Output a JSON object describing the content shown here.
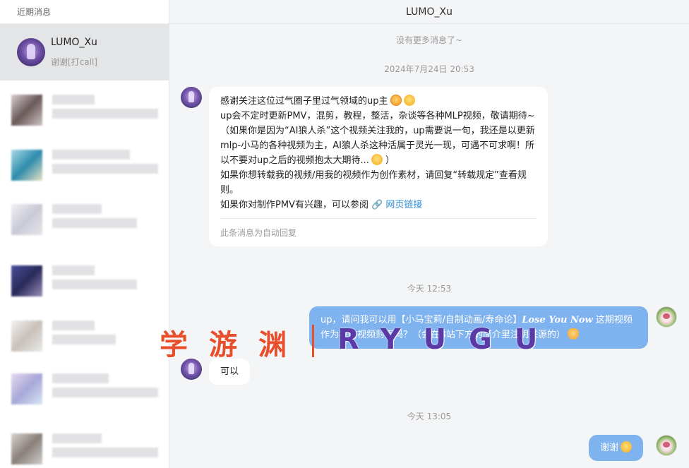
{
  "sidebar": {
    "header": "近期消息",
    "active_conversation": {
      "name": "LUMO_Xu",
      "preview": "谢谢[打call]"
    }
  },
  "chat": {
    "title": "LUMO_Xu",
    "no_more": "没有更多消息了~",
    "messages": [
      {
        "type": "timestamp",
        "text": "2024年7月24日 20:53"
      },
      {
        "type": "incoming",
        "lines": [
          "感谢关注这位过气圈子里过气领域的up主",
          "up会不定时更新PMV，混剪，教程，整活，杂谈等各种MLP视频，敬请期待~",
          "（如果你是因为“AI狼人杀”这个视频关注我的，up需要说一句，我还是以更新mlp-小马的各种视频为主，AI狼人杀这种活属于灵光一现，可遇不可求啊！所以不要对up之后的视频抱太大期待...",
          "）",
          "如果你想转载我的视频/用我的视频作为创作素材，请回复“转载规定”查看规则。",
          "如果你对制作PMV有兴趣，可以参阅"
        ],
        "link": "🔗 网页链接",
        "footer": "此条消息为自动回复"
      },
      {
        "type": "timestamp",
        "text": "今天 12:53"
      },
      {
        "type": "outgoing",
        "text_before": "up，请问我可以用【小马宝莉/自制动画/寿命论】",
        "text_italic": "Lose You Now",
        "text_after": " 这期视频作为我的视频封面吗？（会在B站下方的简介里注明来源的）"
      },
      {
        "type": "incoming",
        "text": "可以"
      },
      {
        "type": "timestamp",
        "text": "今天 13:05"
      },
      {
        "type": "outgoing",
        "text": "谢谢"
      }
    ]
  },
  "watermark": {
    "cn": "学游渊",
    "en": "RYUGU"
  }
}
